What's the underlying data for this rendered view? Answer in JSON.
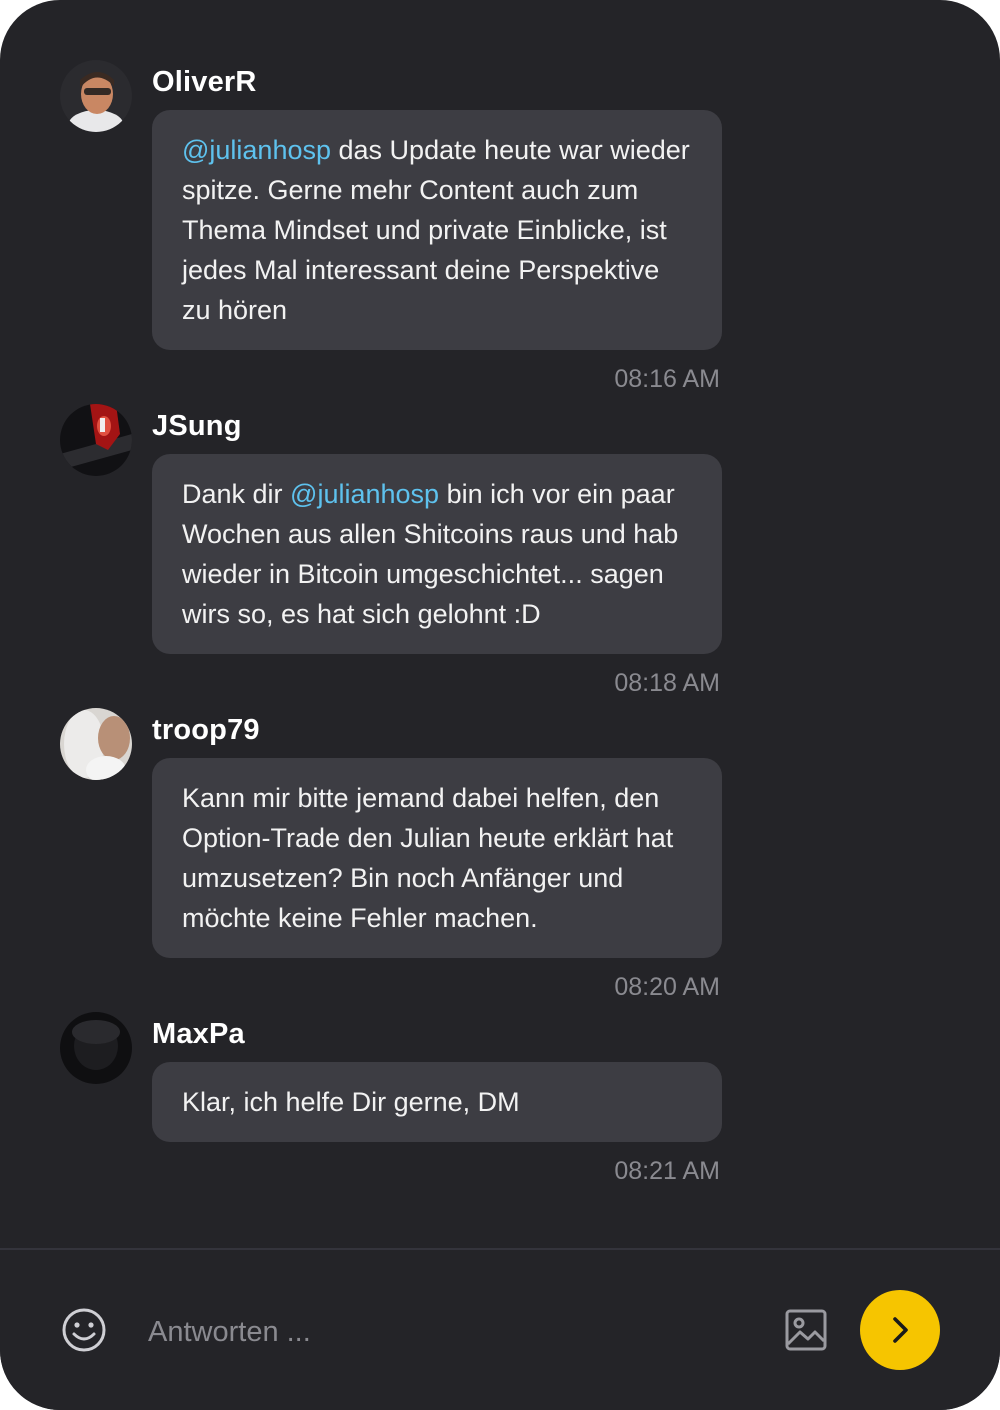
{
  "messages": [
    {
      "author": "OliverR",
      "mention": "@julianhosp",
      "text_before": "",
      "text_after": " das Update heute war wieder spitze. Gerne mehr Content auch zum Thema Mindset und private Einblicke, ist jedes Mal interessant deine Perspektive zu hören",
      "time": "08:16 AM",
      "avatar_icon": "avatar-photo"
    },
    {
      "author": "JSung",
      "mention": "@julianhosp",
      "text_before": "Dank dir ",
      "text_after": " bin ich vor ein paar Wochen aus allen Shitcoins raus und hab wieder in Bitcoin umgeschichtet... sagen wirs so, es hat sich gelohnt :D",
      "time": "08:18 AM",
      "avatar_icon": "avatar-photo"
    },
    {
      "author": "troop79",
      "text": "Kann mir bitte jemand dabei helfen, den Option-Trade den Julian heute erklärt hat umzusetzen? Bin noch Anfänger und möchte keine Fehler machen.",
      "time": "08:20 AM",
      "avatar_icon": "avatar-photo"
    },
    {
      "author": "MaxPa",
      "text": "Klar, ich helfe Dir gerne, DM",
      "time": "08:21 AM",
      "avatar_icon": "avatar-photo"
    }
  ],
  "composer": {
    "placeholder": "Antworten ...",
    "emoji_icon": "smiley-icon",
    "image_icon": "image-icon",
    "send_icon": "chevron-right-icon"
  },
  "colors": {
    "background": "#242428",
    "bubble": "#3d3d43",
    "mention": "#5ec2ee",
    "timestamp": "#8a8a90",
    "send_button": "#f6c500"
  }
}
